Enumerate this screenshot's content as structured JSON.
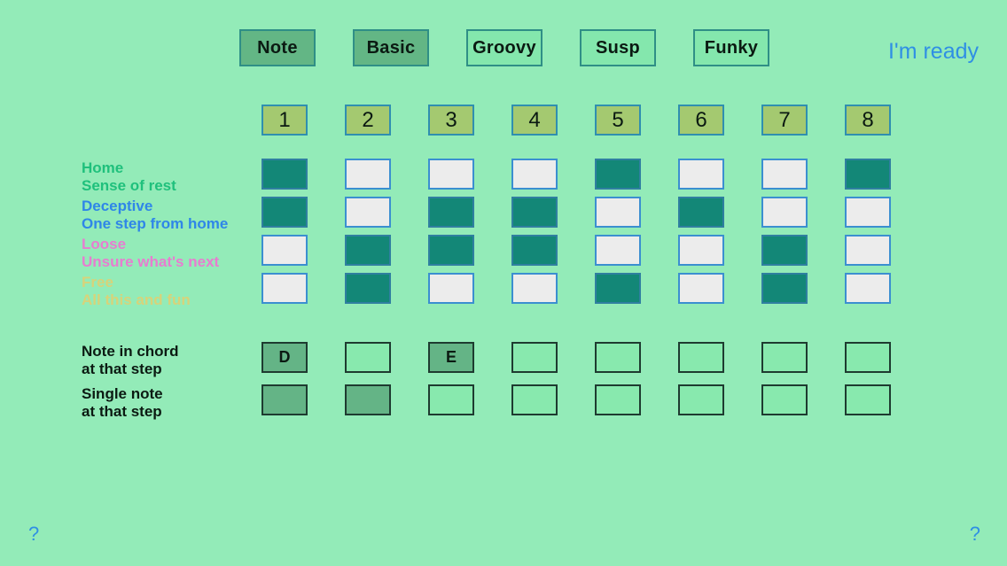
{
  "tabs": [
    {
      "label": "Note",
      "active": true
    },
    {
      "label": "Basic",
      "active": true
    },
    {
      "label": "Groovy",
      "active": false
    },
    {
      "label": "Susp",
      "active": false
    },
    {
      "label": "Funky",
      "active": false
    }
  ],
  "ready_label": "I'm ready",
  "steps": [
    "1",
    "2",
    "3",
    "4",
    "5",
    "6",
    "7",
    "8"
  ],
  "chord_rows": [
    {
      "title": "Home",
      "subtitle": "Sense of rest",
      "color": "#1fc07c",
      "cells": [
        true,
        false,
        false,
        false,
        true,
        false,
        false,
        true
      ]
    },
    {
      "title": "Deceptive",
      "subtitle": "One step from home",
      "color": "#2f86e8",
      "cells": [
        true,
        false,
        true,
        true,
        false,
        true,
        false,
        false
      ]
    },
    {
      "title": "Loose",
      "subtitle": "Unsure what's next",
      "color": "#e77dd0",
      "cells": [
        false,
        true,
        true,
        true,
        false,
        false,
        true,
        false
      ]
    },
    {
      "title": "Free",
      "subtitle": "All this and fun",
      "color": "#d7d37a",
      "cells": [
        false,
        true,
        false,
        false,
        true,
        false,
        true,
        false
      ]
    }
  ],
  "note_rows": [
    {
      "title": "Note in chord",
      "subtitle": "at that step",
      "cells": [
        {
          "text": "D",
          "filled": true
        },
        {
          "text": "",
          "filled": false
        },
        {
          "text": "E",
          "filled": true
        },
        {
          "text": "",
          "filled": false
        },
        {
          "text": "",
          "filled": false
        },
        {
          "text": "",
          "filled": false
        },
        {
          "text": "",
          "filled": false
        },
        {
          "text": "",
          "filled": false
        }
      ]
    },
    {
      "title": "Single note",
      "subtitle": "at that step",
      "cells": [
        {
          "text": "",
          "filled": true
        },
        {
          "text": "",
          "filled": true
        },
        {
          "text": "",
          "filled": false
        },
        {
          "text": "",
          "filled": false
        },
        {
          "text": "",
          "filled": false
        },
        {
          "text": "",
          "filled": false
        },
        {
          "text": "",
          "filled": false
        },
        {
          "text": "",
          "filled": false
        }
      ]
    }
  ],
  "help_label": "?"
}
